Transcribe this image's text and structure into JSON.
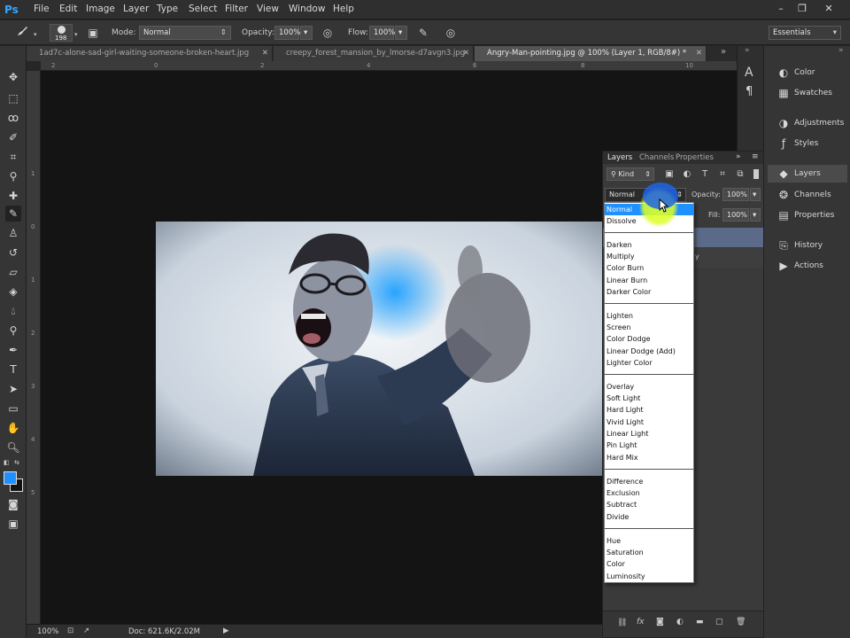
{
  "app": {
    "logo": "Ps",
    "menus": [
      "File",
      "Edit",
      "Image",
      "Layer",
      "Type",
      "Select",
      "Filter",
      "View",
      "Window",
      "Help"
    ],
    "window_buttons": [
      "–",
      "❐",
      "✕"
    ]
  },
  "options_bar": {
    "brush_size": "198",
    "mode_label": "Mode:",
    "mode_value": "Normal",
    "opacity_label": "Opacity:",
    "opacity_value": "100%",
    "flow_label": "Flow:",
    "flow_value": "100%",
    "workspace": "Essentials"
  },
  "tabs": [
    {
      "label": "1ad7c-alone-sad-girl-waiting-someone-broken-heart.jpg",
      "active": false
    },
    {
      "label": "creepy_forest_mansion_by_lmorse-d7avgn3.jpg",
      "active": false
    },
    {
      "label": "Angry-Man-pointing.jpg @ 100% (Layer 1, RGB/8#) *",
      "active": true
    }
  ],
  "ruler_top": [
    "2",
    "0",
    "2",
    "4",
    "6",
    "8",
    "10"
  ],
  "ruler_left": [
    "1",
    "0",
    "1",
    "2",
    "3",
    "4",
    "5"
  ],
  "status": {
    "zoom": "100%",
    "doc": "Doc: 621.6K/2.02M"
  },
  "dock": {
    "items": [
      {
        "label": "Color",
        "icon": "color-wheel-icon",
        "glyph": "◐"
      },
      {
        "label": "Swatches",
        "icon": "grid-icon",
        "glyph": "▦"
      },
      {
        "label": "Adjustments",
        "icon": "adjustments-icon",
        "glyph": "◑"
      },
      {
        "label": "Styles",
        "icon": "fx-icon",
        "glyph": "ƒ"
      },
      {
        "label": "Layers",
        "icon": "layers-icon",
        "glyph": "◆"
      },
      {
        "label": "Channels",
        "icon": "channels-icon",
        "glyph": "❂"
      },
      {
        "label": "Properties",
        "icon": "properties-icon",
        "glyph": "▤"
      },
      {
        "label": "History",
        "icon": "history-icon",
        "glyph": "⎘"
      },
      {
        "label": "Actions",
        "icon": "play-icon",
        "glyph": "▶"
      }
    ]
  },
  "layers_panel": {
    "tabs": [
      "Layers",
      "Channels",
      "Properties"
    ],
    "kind_label": "Kind",
    "blend_value": "Normal",
    "opacity_label": "Opacity:",
    "opacity_value": "100%",
    "fill_label": "Fill:",
    "fill_value": "100%",
    "layer_row_fragment": "y"
  },
  "blend_modes": {
    "groups": [
      [
        "Normal",
        "Dissolve"
      ],
      [
        "Darken",
        "Multiply",
        "Color Burn",
        "Linear Burn",
        "Darker Color"
      ],
      [
        "Lighten",
        "Screen",
        "Color Dodge",
        "Linear Dodge (Add)",
        "Lighter Color"
      ],
      [
        "Overlay",
        "Soft Light",
        "Hard Light",
        "Vivid Light",
        "Linear Light",
        "Pin Light",
        "Hard Mix"
      ],
      [
        "Difference",
        "Exclusion",
        "Subtract",
        "Divide"
      ],
      [
        "Hue",
        "Saturation",
        "Color",
        "Luminosity"
      ]
    ],
    "selected": "Normal"
  },
  "colors": {
    "accent": "#31a8ff",
    "selection": "#1e90ff",
    "foreground_swatch": "#1e90ff",
    "cursor_highlight": "#dcff28"
  }
}
